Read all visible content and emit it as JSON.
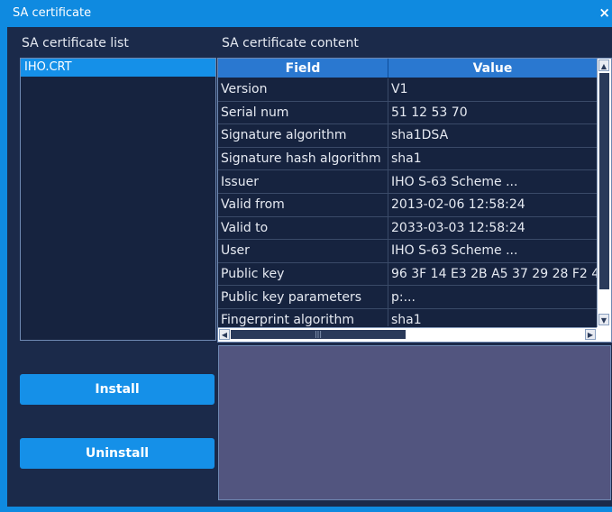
{
  "window": {
    "title": "SA certificate",
    "close_glyph": "×"
  },
  "left": {
    "list_label": "SA certificate list",
    "items": [
      "IHO.CRT"
    ]
  },
  "content": {
    "label": "SA certificate content",
    "columns": [
      "Field",
      "Value"
    ],
    "rows": [
      [
        "Version",
        "V1"
      ],
      [
        "Serial num",
        "51 12 53 70"
      ],
      [
        "Signature algorithm",
        "sha1DSA"
      ],
      [
        "Signature hash algorithm",
        "sha1"
      ],
      [
        "Issuer",
        "IHO S-63 Scheme ..."
      ],
      [
        "Valid from",
        "2013-02-06 12:58:24"
      ],
      [
        "Valid to",
        "2033-03-03 12:58:24"
      ],
      [
        "User",
        "IHO S-63 Scheme ..."
      ],
      [
        "Public key",
        "96 3F 14 E3 2B A5 37 29 28 F2 4..."
      ],
      [
        "Public key parameters",
        "p:..."
      ],
      [
        "Fingerprint algorithm",
        "sha1"
      ]
    ]
  },
  "buttons": {
    "install": "Install",
    "uninstall": "Uninstall"
  },
  "icons": {
    "scroll_up": "scroll-up-arrow-icon",
    "scroll_down": "scroll-down-arrow-icon",
    "scroll_left": "scroll-left-arrow-icon",
    "scroll_right": "scroll-right-arrow-icon",
    "close": "close-icon"
  },
  "colors": {
    "accent": "#1590e8",
    "panel": "#1b2a4a",
    "detail": "#52557f"
  }
}
